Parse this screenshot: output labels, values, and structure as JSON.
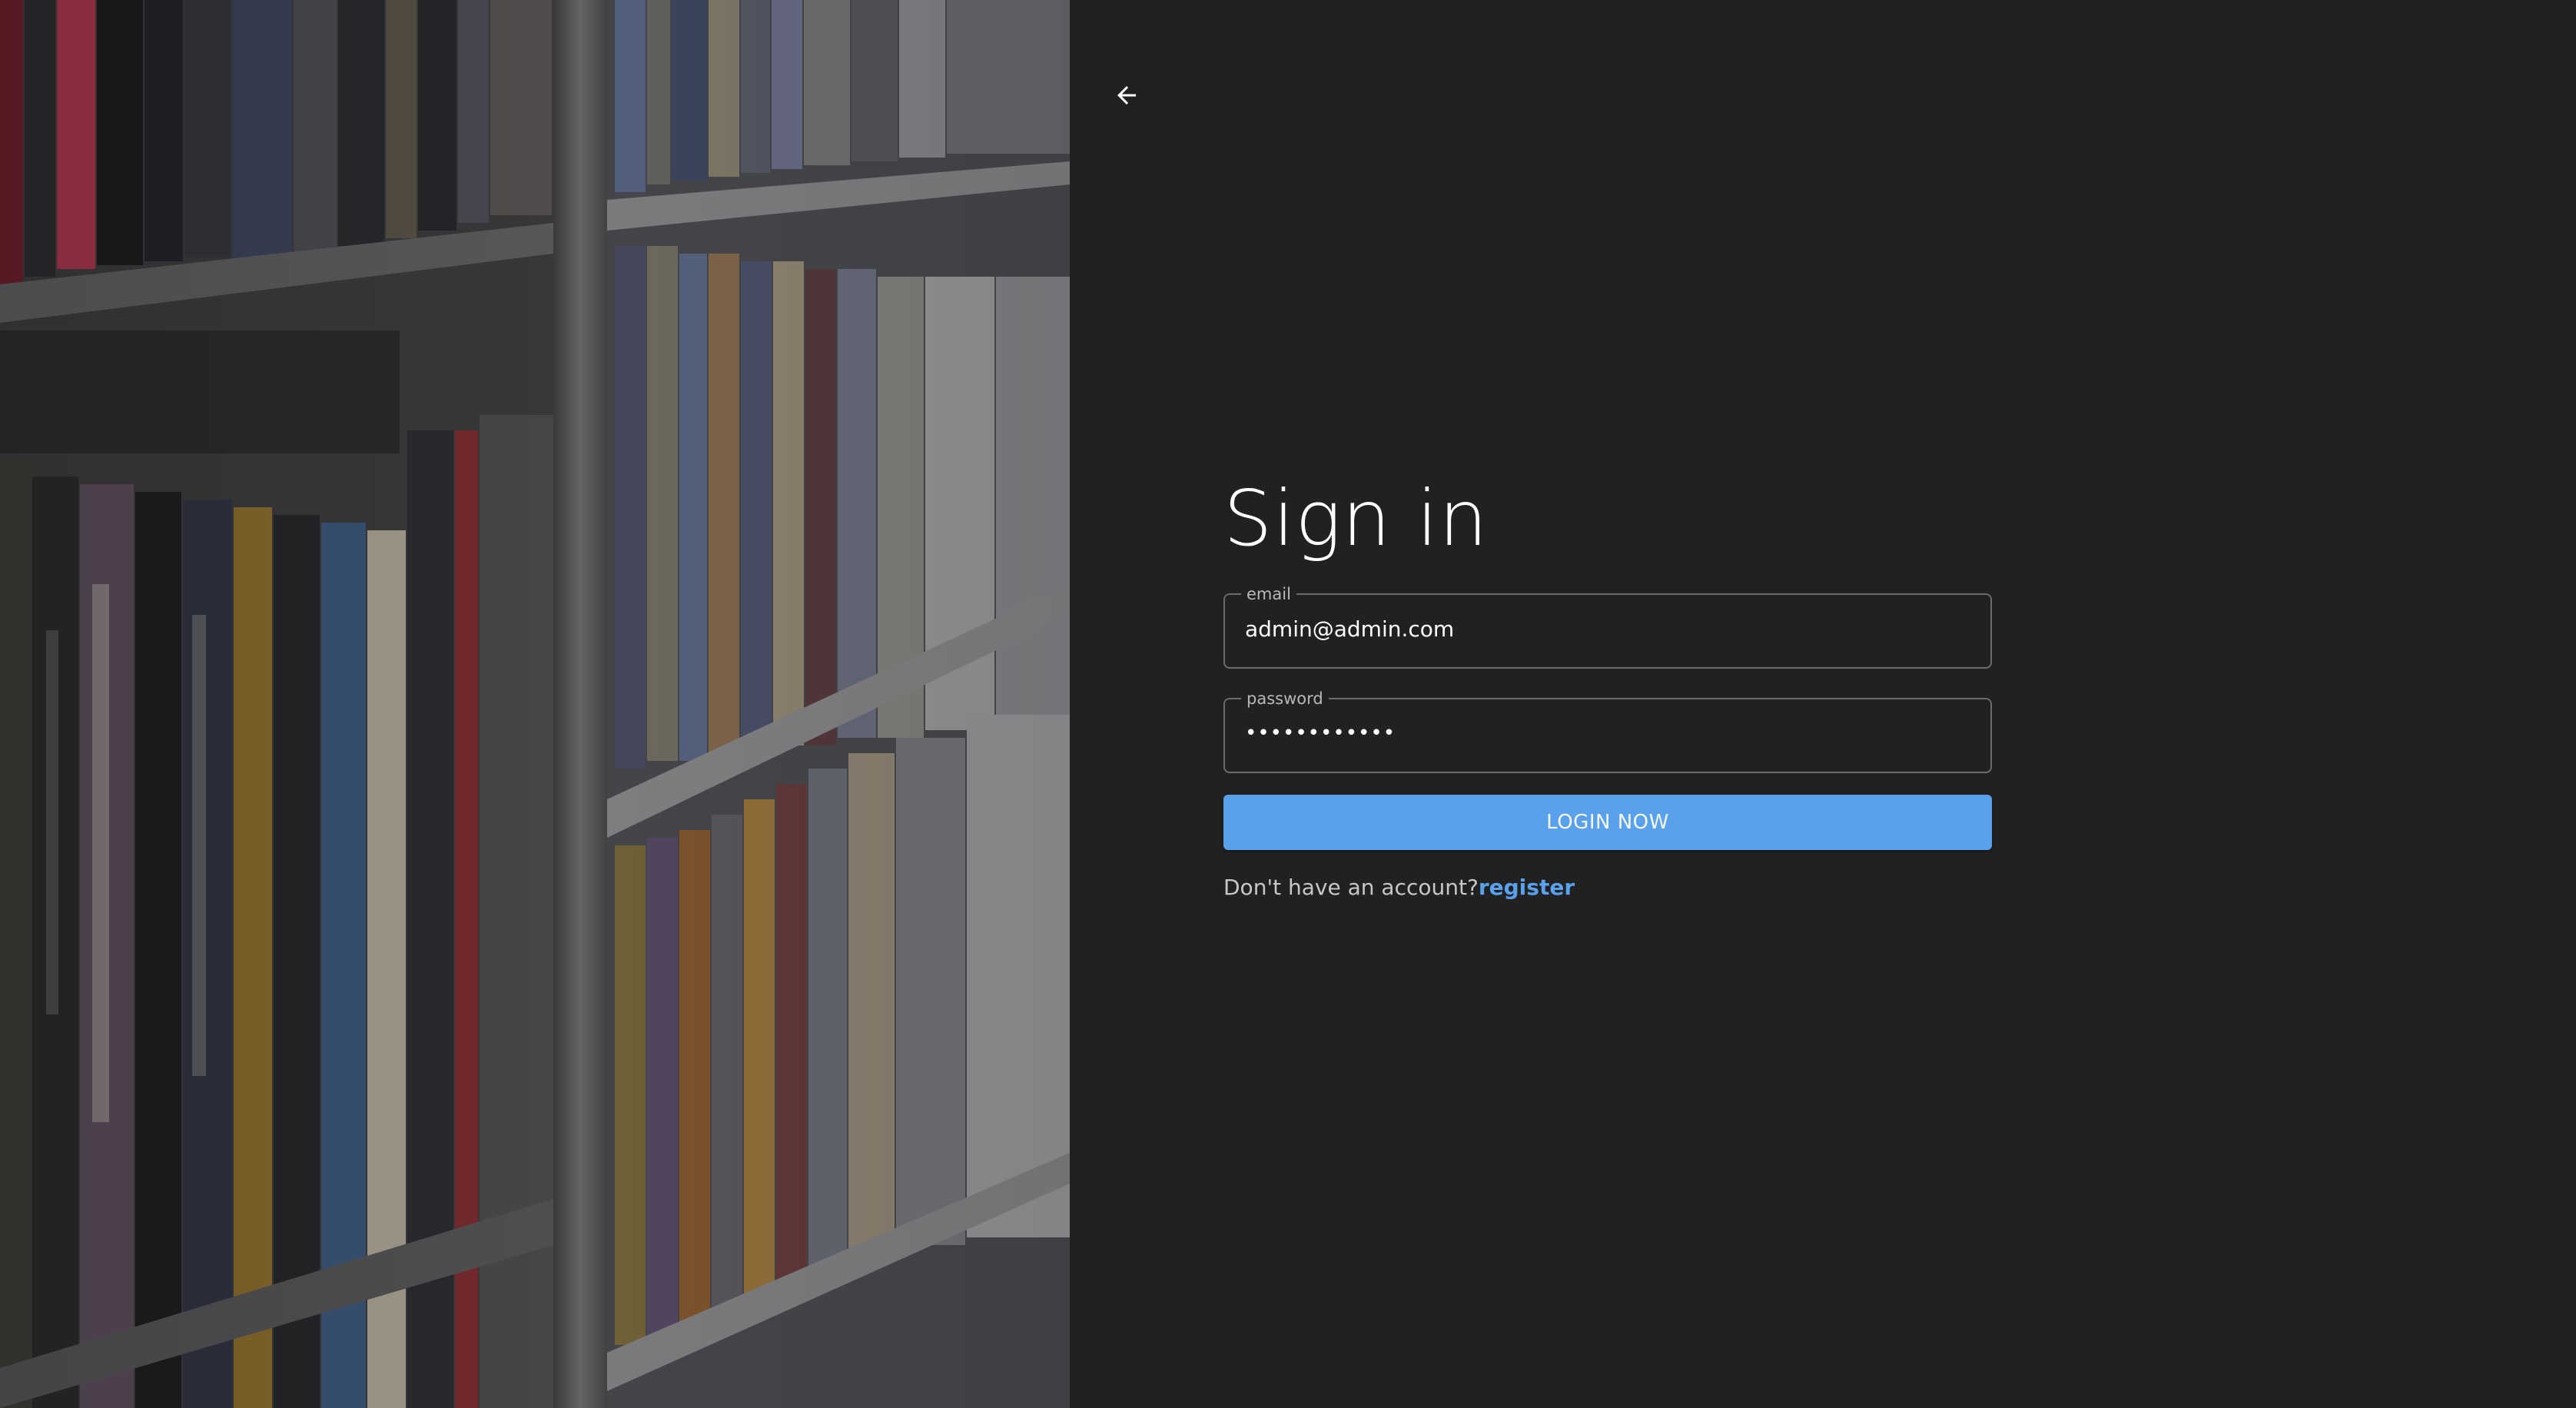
{
  "hero": {
    "image_name": "bookshelf-photo"
  },
  "header": {
    "back_icon": "arrow-left-icon"
  },
  "signin": {
    "title": "Sign in",
    "email": {
      "label": "email",
      "value": "admin@admin.com"
    },
    "password": {
      "label": "password",
      "value": "••••••••••••"
    },
    "login_label": "LOGIN NOW",
    "no_account_text": "Don't have an account?",
    "register_label": "register"
  },
  "colors": {
    "background": "#212121",
    "accent": "#5aa1ec",
    "field_border": "#6b6b6b",
    "text": "#ffffff"
  }
}
